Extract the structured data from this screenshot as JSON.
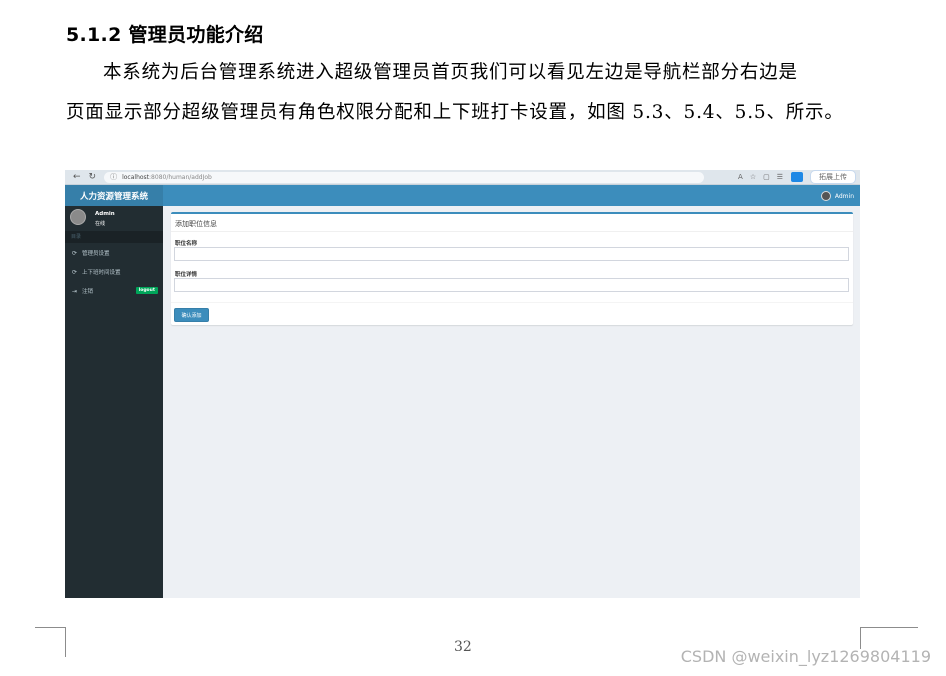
{
  "document": {
    "heading": "5.1.2 管理员功能介绍",
    "paragraph_line1": "本系统为后台管理系统进入超级管理员首页我们可以看见左边是导航栏部分右边是",
    "paragraph_line2": "页面显示部分超级管理员有角色权限分配和上下班打卡设置，如图 5.3、5.4、5.5、所示。",
    "page_number": "32",
    "watermark": "CSDN @weixin_lyz1269804119"
  },
  "screenshot": {
    "browser": {
      "url_host": "localhost",
      "url_path": ":8080/human/addJob",
      "sync_label": "拓展上传"
    },
    "app": {
      "brand": "人力资源管理系统",
      "top_user": "Admin",
      "sidebar": {
        "user_name": "Admin",
        "user_status": "在线",
        "header": "目录",
        "items": [
          {
            "label": "管理员设置",
            "icon": "refresh-icon"
          },
          {
            "label": "上下班时间设置",
            "icon": "refresh-icon"
          },
          {
            "label": "注销",
            "icon": "logout-icon",
            "badge": "logout"
          }
        ]
      },
      "form": {
        "title": "添加职位信息",
        "field1_label": "职位名称",
        "field2_label": "职位详情",
        "submit_label": "确认添加"
      }
    }
  }
}
